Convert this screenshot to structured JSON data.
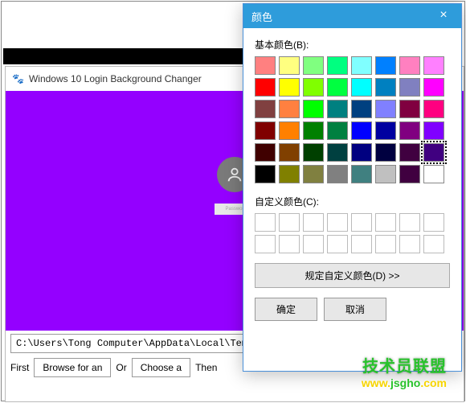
{
  "black_bar": {},
  "main": {
    "title": "Windows 10 Login Background Changer",
    "close": "×",
    "preview": {
      "name_placeholder": "Passwor",
      "bg_color": "#9400ff"
    },
    "path": "C:\\Users\\Tong Computer\\AppData\\Local\\Temp\\BackgroundChang",
    "first": "First",
    "browse": "Browse for an",
    "or": "Or",
    "choose": "Choose a",
    "then": "Then"
  },
  "dlg": {
    "title": "颜色",
    "close": "×",
    "basic_label": "基本颜色(B):",
    "colors": [
      "#ff8080",
      "#ffff80",
      "#80ff80",
      "#00ff80",
      "#80ffff",
      "#0080ff",
      "#ff80c0",
      "#ff80ff",
      "#ff0000",
      "#ffff00",
      "#80ff00",
      "#00ff40",
      "#00ffff",
      "#0080c0",
      "#8080c0",
      "#ff00ff",
      "#804040",
      "#ff8040",
      "#00ff00",
      "#008080",
      "#004080",
      "#8080ff",
      "#800040",
      "#ff0080",
      "#800000",
      "#ff8000",
      "#008000",
      "#008040",
      "#0000ff",
      "#0000a0",
      "#800080",
      "#8000ff",
      "#400000",
      "#804000",
      "#004000",
      "#004040",
      "#000080",
      "#000040",
      "#400040",
      "#400080",
      "#000000",
      "#808000",
      "#808040",
      "#808080",
      "#408080",
      "#c0c0c0",
      "#400040",
      "#ffffff"
    ],
    "selected_index": 39,
    "custom_label": "自定义颜色(C):",
    "define": "规定自定义颜色(D) >>",
    "ok": "确定",
    "cancel": "取消"
  },
  "watermark": {
    "text": "技术员联盟",
    "url_www": "www.",
    "url_mid": "jsgho",
    "url_com": ".com"
  }
}
